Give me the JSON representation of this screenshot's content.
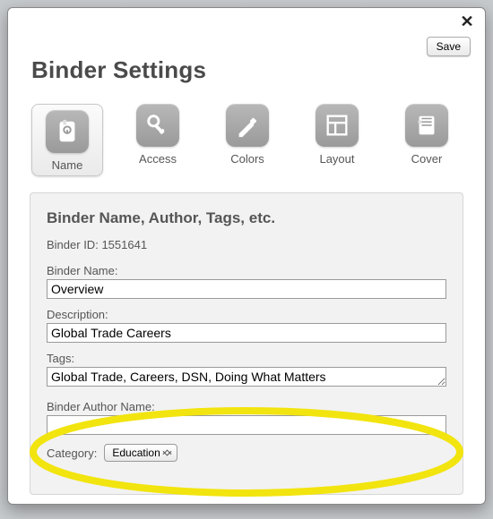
{
  "dialog": {
    "title": "Binder Settings",
    "save_label": "Save",
    "close_label": "✕"
  },
  "tabs": [
    {
      "id": "name",
      "label": "Name",
      "active": true
    },
    {
      "id": "access",
      "label": "Access",
      "active": false
    },
    {
      "id": "colors",
      "label": "Colors",
      "active": false
    },
    {
      "id": "layout",
      "label": "Layout",
      "active": false
    },
    {
      "id": "cover",
      "label": "Cover",
      "active": false
    }
  ],
  "panel": {
    "heading": "Binder Name, Author, Tags, etc.",
    "binder_id_label": "Binder ID:",
    "binder_id_value": "1551641",
    "binder_name_label": "Binder Name:",
    "binder_name_value": "Overview",
    "description_label": "Description:",
    "description_value": "Global Trade Careers",
    "tags_label": "Tags:",
    "tags_value": "Global Trade, Careers, DSN, Doing What Matters",
    "author_label": "Binder Author Name:",
    "author_value": "",
    "category_label": "Category:",
    "category_value": "Education"
  },
  "colors": {
    "highlight": "#f2e40e"
  }
}
